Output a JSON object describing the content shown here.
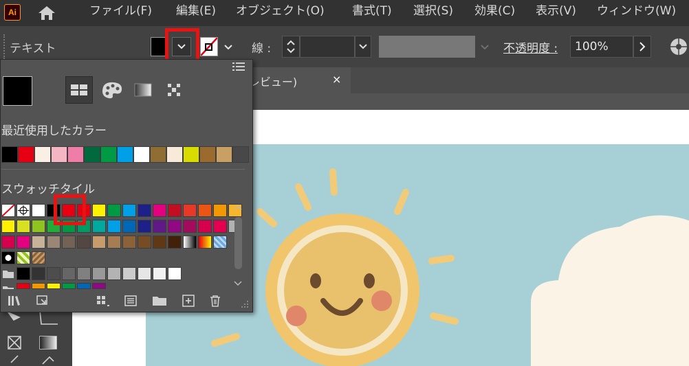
{
  "app": {
    "logo_text": "Ai",
    "menu": [
      "ファイル(F)",
      "編集(E)",
      "オブジェクト(O)",
      "書式(T)",
      "選択(S)",
      "効果(C)",
      "表示(V)",
      "ウィンドウ(W)"
    ]
  },
  "control_bar": {
    "context_label": "テキスト",
    "stroke_label": "線 :",
    "opacity_label": "不透明度 :",
    "opacity_value": "100%"
  },
  "document": {
    "tab_label": "K/プレビュー)",
    "tab_close": "×"
  },
  "swatch_panel": {
    "recent_label": "最近使用したカラー",
    "swatches_label": "スウォッチタイル",
    "current_fill_color": "#000000",
    "recent_colors": [
      "#000000",
      "#e60012",
      "#f9efe4",
      "#f5b6c4",
      "#ee7ea8",
      "#00693e",
      "#009944",
      "#00a0e9",
      "#ffffff",
      "#8f6d33",
      "#f8ead8",
      "#d9dc00",
      "#9a6a2f",
      "#c9a063"
    ]
  },
  "highlight_color": "#e81414",
  "icons": [
    "home-icon",
    "chevron-down-icon",
    "panel-menu-icon",
    "swatch-view-icon",
    "color-palette-icon",
    "gradient-icon",
    "pattern-icon",
    "libraries-icon",
    "place-icon",
    "new-group-icon",
    "folder-icon",
    "new-swatch-icon",
    "trash-icon",
    "recolor-icon"
  ]
}
